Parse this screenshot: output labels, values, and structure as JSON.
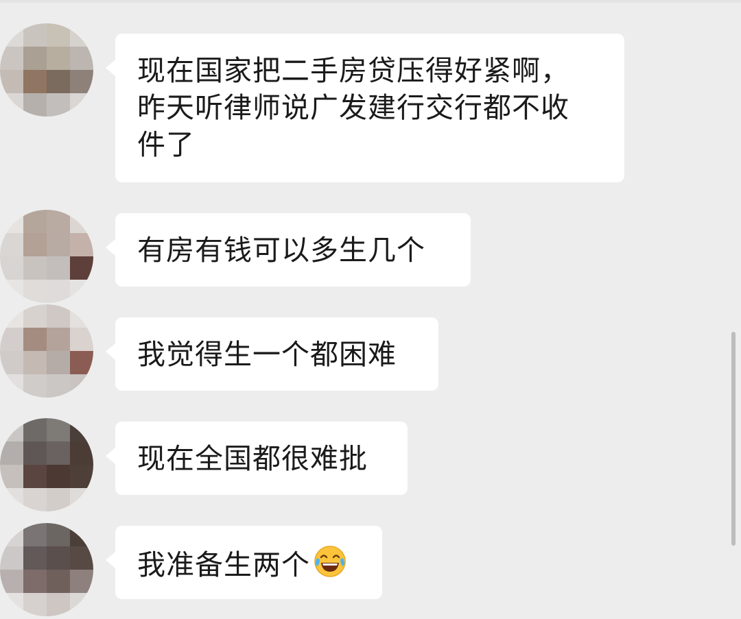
{
  "messages": [
    {
      "text_lines": [
        "现在国家把二手房贷压得好紧啊，",
        "昨天听律师说广发建行交行都不收",
        "件了"
      ]
    },
    {
      "text": "有房有钱可以多生几个"
    },
    {
      "text": "我觉得生一个都困难"
    },
    {
      "text": "现在全国都很难批"
    },
    {
      "text": "我准备生两个",
      "emoji": "face-with-tears-of-joy-icon"
    }
  ],
  "colors": {
    "background": "#ededed",
    "bubble": "#ffffff",
    "text": "#1a1a1a"
  }
}
